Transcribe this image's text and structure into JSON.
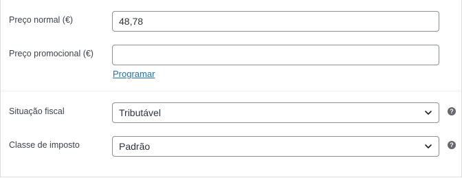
{
  "pricing": {
    "regular_price_label": "Preço normal (€)",
    "regular_price_value": "48,78",
    "sale_price_label": "Preço promocional (€)",
    "sale_price_value": "",
    "schedule_link": "Programar"
  },
  "tax": {
    "status_label": "Situação fiscal",
    "status_value": "Tributável",
    "class_label": "Classe de imposto",
    "class_value": "Padrão",
    "help_glyph": "?"
  },
  "icons": {
    "dropdown": "chevron-down-icon",
    "help": "help-icon"
  },
  "colors": {
    "link": "#2271b1",
    "help_badge": "#646970",
    "border": "#8c8f94"
  }
}
